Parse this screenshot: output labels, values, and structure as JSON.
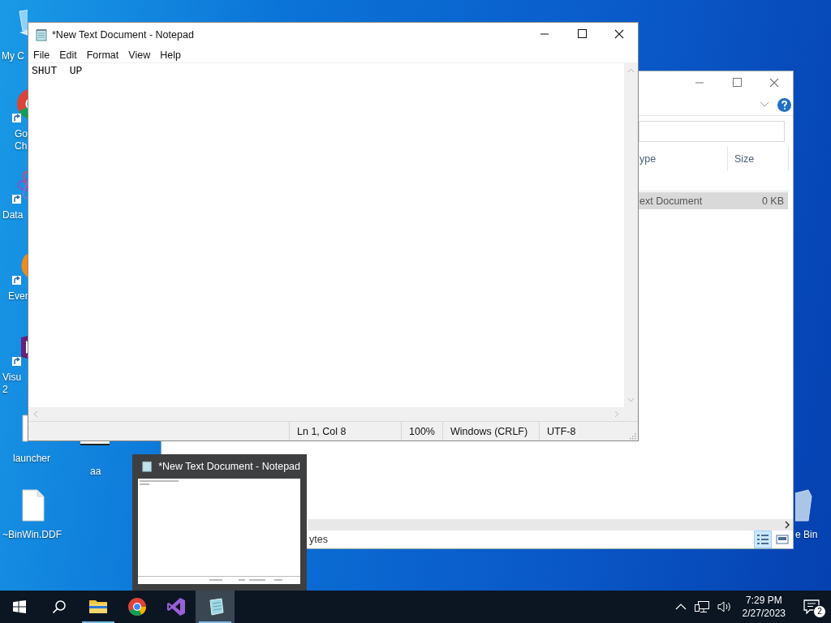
{
  "desktop": {
    "icons": [
      {
        "kind": "computer",
        "label_lines": [
          "My C"
        ],
        "shortcut": false
      },
      {
        "kind": "browser",
        "label_lines": [
          "Go",
          "Ch"
        ],
        "shortcut": true
      },
      {
        "kind": "atom",
        "label_lines": [
          "Data"
        ],
        "shortcut": true
      },
      {
        "kind": "blob",
        "label_lines": [
          "Ever"
        ],
        "shortcut": true
      },
      {
        "kind": "studio",
        "label_lines": [
          "Visu",
          "2"
        ],
        "shortcut": true
      },
      {
        "kind": "gear-file",
        "label_lines": [
          "launcher"
        ],
        "shortcut": false
      },
      {
        "kind": "page",
        "label_lines": [
          "aa"
        ],
        "shortcut": false
      },
      {
        "kind": "file",
        "label_lines": [
          "~BinWin.DDF"
        ],
        "shortcut": false
      },
      {
        "kind": "bin",
        "label_lines": [
          "e Bin"
        ],
        "shortcut": false
      }
    ]
  },
  "explorer_window": {
    "columns": [
      "ype",
      "Size"
    ],
    "rows": [
      {
        "cells": [
          "ext Document",
          "0 KB"
        ],
        "selected": true
      }
    ],
    "status_text": "ytes",
    "views": [
      {
        "kind": "details",
        "selected": true
      },
      {
        "kind": "large-icons",
        "selected": false
      }
    ]
  },
  "notepad": {
    "title": "*New Text Document - Notepad",
    "menu": [
      "File",
      "Edit",
      "Format",
      "View",
      "Help"
    ],
    "text": "SHUT  UP",
    "status": [
      "Ln 1, Col 8",
      "100%",
      "Windows (CRLF)",
      "UTF-8"
    ]
  },
  "taskbar_preview": {
    "title": "*New Text Document - Notepad"
  },
  "taskbar": {
    "apps": [
      {
        "kind": "explorer",
        "running": true,
        "active": false
      },
      {
        "kind": "browser",
        "running": false,
        "active": false
      },
      {
        "kind": "studio",
        "running": false,
        "active": false
      },
      {
        "kind": "notepad",
        "running": true,
        "active": true
      }
    ],
    "time": "7:29 PM",
    "date": "2/27/2023",
    "notification_count": "2"
  }
}
